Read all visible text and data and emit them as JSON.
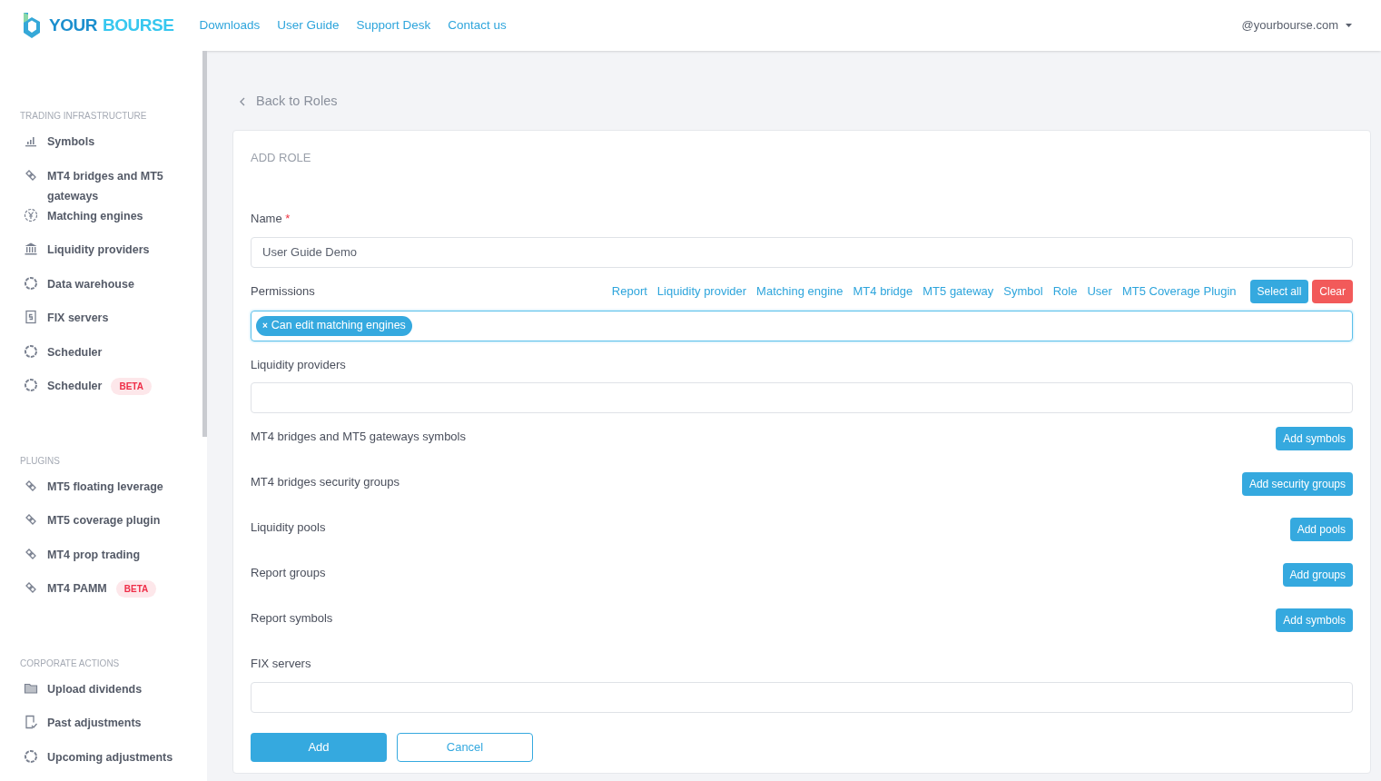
{
  "header": {
    "logo": {
      "first": "YOUR",
      "second": "BOURSE"
    },
    "nav": [
      "Downloads",
      "User Guide",
      "Support Desk",
      "Contact us"
    ],
    "account": "@yourbourse.com"
  },
  "sidebar": {
    "sections": [
      {
        "title": "TRADING INFRASTRUCTURE",
        "items": [
          {
            "label": "Symbols",
            "kind": "bars"
          },
          {
            "label": "MT4 bridges and MT5 gateways",
            "kind": "link"
          },
          {
            "label": "Matching engines",
            "kind": "yen"
          },
          {
            "label": "Liquidity providers",
            "kind": "bank"
          },
          {
            "label": "Data warehouse",
            "kind": "ring"
          },
          {
            "label": "FIX servers",
            "kind": "doc"
          },
          {
            "label": "Scheduler",
            "kind": "ring"
          },
          {
            "label": "Scheduler",
            "kind": "ring",
            "badge": "BETA"
          }
        ]
      },
      {
        "title": "PLUGINS",
        "items": [
          {
            "label": "MT5 floating leverage",
            "kind": "link"
          },
          {
            "label": "MT5 coverage plugin",
            "kind": "link"
          },
          {
            "label": "MT4 prop trading",
            "kind": "link"
          },
          {
            "label": "MT4 PAMM",
            "kind": "link",
            "badge": "BETA"
          }
        ]
      },
      {
        "title": "CORPORATE ACTIONS",
        "items": [
          {
            "label": "Upload dividends",
            "kind": "folder"
          },
          {
            "label": "Past adjustments",
            "kind": "check"
          },
          {
            "label": "Upcoming adjustments",
            "kind": "ring"
          }
        ]
      }
    ]
  },
  "back_link": "Back to Roles",
  "form": {
    "title": "ADD ROLE",
    "name": {
      "label": "Name",
      "required_mark": "*",
      "value": "User Guide Demo"
    },
    "permissions": {
      "label": "Permissions",
      "filters": [
        "Report",
        "Liquidity provider",
        "Matching engine",
        "MT4 bridge",
        "MT5 gateway",
        "Symbol",
        "Role",
        "User",
        "MT5 Coverage Plugin"
      ],
      "select_all": "Select all",
      "clear": "Clear",
      "tags": [
        "Can edit matching engines"
      ],
      "remove_mark": "×",
      "focused": true
    },
    "fields": [
      {
        "kind": "input",
        "label": "Liquidity providers"
      },
      {
        "kind": "button",
        "label": "MT4 bridges and MT5 gateways symbols",
        "button": "Add symbols"
      },
      {
        "kind": "button",
        "label": "MT4 bridges security groups",
        "button": "Add security groups"
      },
      {
        "kind": "button",
        "label": "Liquidity pools",
        "button": "Add pools"
      },
      {
        "kind": "button",
        "label": "Report groups",
        "button": "Add groups"
      },
      {
        "kind": "button",
        "label": "Report symbols",
        "button": "Add symbols"
      },
      {
        "kind": "input",
        "label": "FIX servers"
      }
    ],
    "submit": "Add",
    "cancel": "Cancel"
  }
}
